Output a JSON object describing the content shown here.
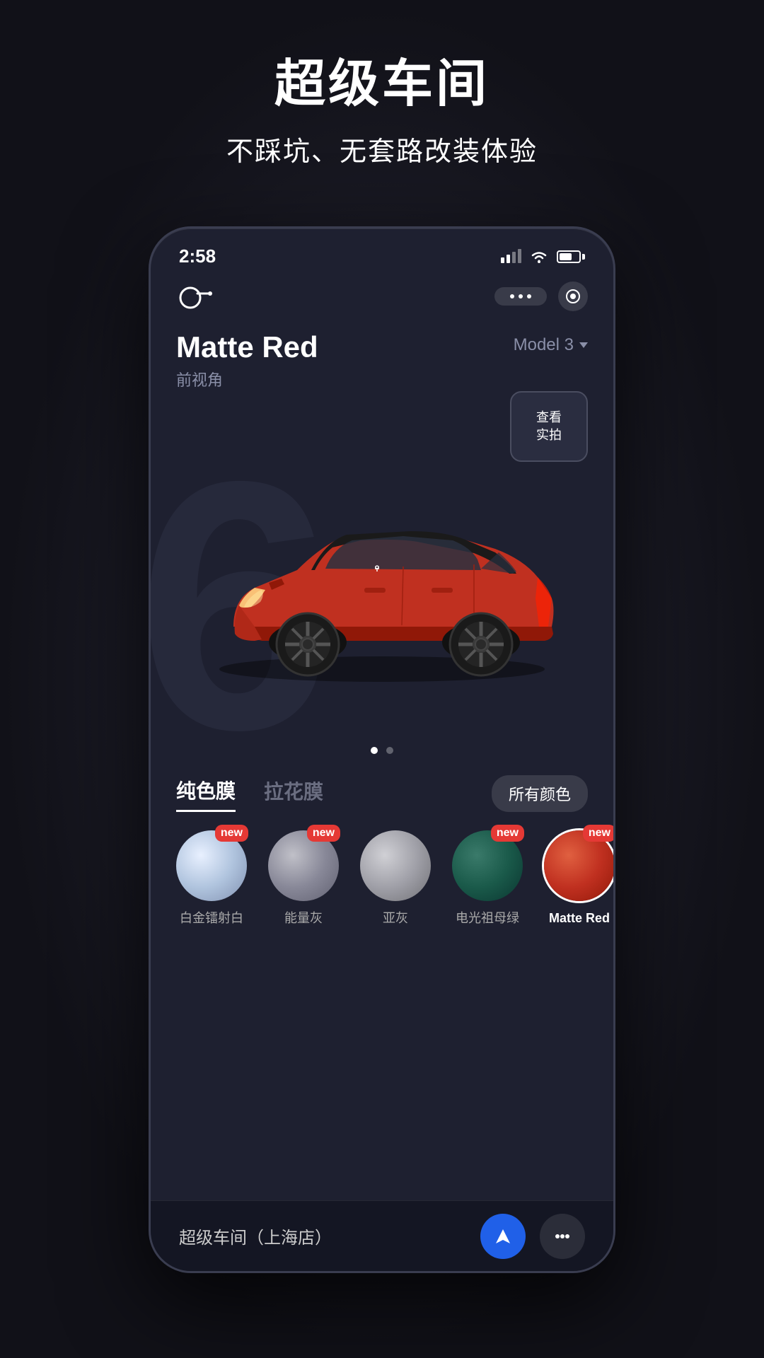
{
  "background": {
    "color": "#1a1a1a"
  },
  "page_header": {
    "title": "超级车间",
    "subtitle": "不踩坑、无套路改装体验"
  },
  "phone": {
    "status_bar": {
      "time": "2:58",
      "signal": true,
      "wifi": true,
      "battery": true
    },
    "nav": {
      "more_label": "•••",
      "record_label": "⊙"
    },
    "car_info": {
      "name": "Matte Red",
      "angle": "前视角",
      "model": "Model 3",
      "model_chevron": "▾"
    },
    "preview": {
      "line1": "查看",
      "line2": "实拍"
    },
    "carousel_dots": [
      {
        "active": true
      },
      {
        "active": false
      }
    ],
    "film_tabs": {
      "tab1": "纯色膜",
      "tab2": "拉花膜",
      "all_btn": "所有颜色"
    },
    "swatches": [
      {
        "id": "platinum",
        "label": "白金镭射白",
        "is_new": true,
        "selected": false
      },
      {
        "id": "gray_energy",
        "label": "能量灰",
        "is_new": true,
        "selected": false
      },
      {
        "id": "gray_sub",
        "label": "亚灰",
        "is_new": false,
        "selected": false
      },
      {
        "id": "green",
        "label": "电光祖母绿",
        "is_new": true,
        "selected": false
      },
      {
        "id": "red",
        "label": "Matte Red",
        "is_new": true,
        "selected": true
      }
    ],
    "bottom_bar": {
      "shop_label": "超级车间（上海店）"
    }
  }
}
